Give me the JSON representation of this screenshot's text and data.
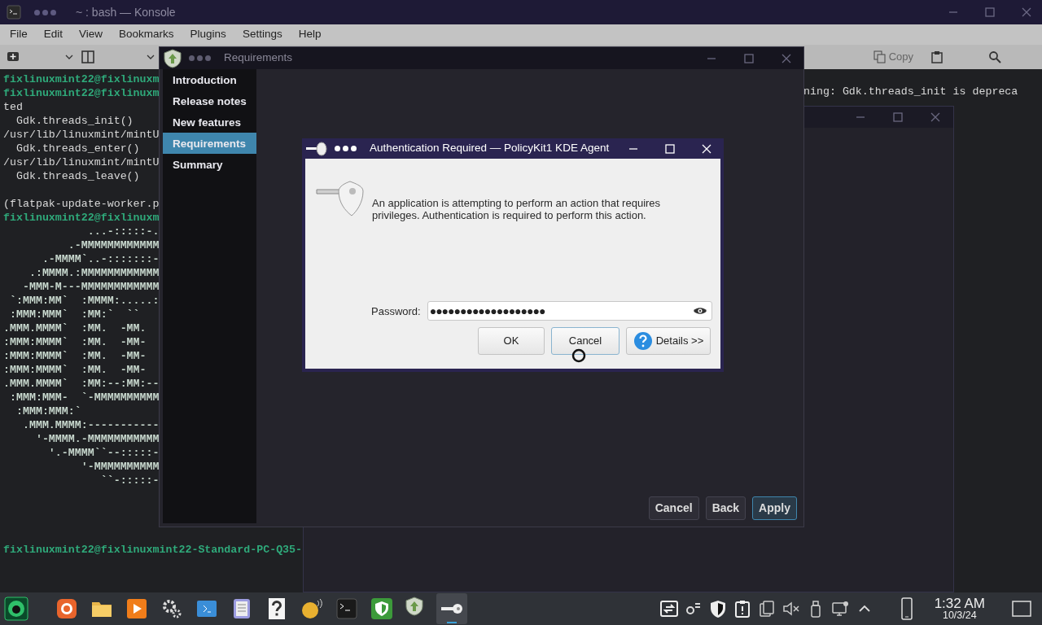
{
  "konsole": {
    "title": "~ : bash — Konsole",
    "menu": [
      "File",
      "Edit",
      "View",
      "Bookmarks",
      "Plugins",
      "Settings",
      "Help"
    ],
    "toolbar_right": {
      "copy_label": "Copy"
    },
    "terminal": {
      "lines": [
        {
          "kind": "prompt",
          "text": "fixlinuxmint22@fixlinuxm"
        },
        {
          "kind": "prompt",
          "text": "fixlinuxmint22@fixlinuxm"
        },
        {
          "kind": "output",
          "text": "ted"
        },
        {
          "kind": "output",
          "text": "  Gdk.threads_init()"
        },
        {
          "kind": "output",
          "text": "/usr/lib/linuxmint/mintU"
        },
        {
          "kind": "output",
          "text": "  Gdk.threads_enter()"
        },
        {
          "kind": "output",
          "text": "/usr/lib/linuxmint/mintU"
        },
        {
          "kind": "output",
          "text": "  Gdk.threads_leave()"
        },
        {
          "kind": "blank"
        },
        {
          "kind": "output",
          "text": "(flatpak-update-worker.p"
        },
        {
          "kind": "prompt",
          "text": "fixlinuxmint22@fixlinuxm"
        },
        {
          "kind": "art",
          "text": "             ...-:::::-."
        },
        {
          "kind": "art",
          "text": "          .-MMMMMMMMMMMM"
        },
        {
          "kind": "art",
          "text": "      .-MMMM`..-:::::::-"
        },
        {
          "kind": "art",
          "text": "    .:MMMM.:MMMMMMMMMMMM"
        },
        {
          "kind": "art",
          "text": "   -MMM-M---MMMMMMMMMMMM"
        },
        {
          "kind": "art",
          "text": " `:MMM:MM`  :MMMM:.....:"
        },
        {
          "kind": "art",
          "text": " :MMM:MMM`  :MM:`  ``"
        },
        {
          "kind": "art",
          "text": ".MMM.MMMM`  :MM.  -MM."
        },
        {
          "kind": "art",
          "text": ":MMM:MMMM`  :MM.  -MM-"
        },
        {
          "kind": "art",
          "text": ":MMM:MMMM`  :MM.  -MM-"
        },
        {
          "kind": "art",
          "text": ":MMM:MMMM`  :MM.  -MM-"
        },
        {
          "kind": "art",
          "text": ".MMM.MMMM`  :MM:--:MM:--"
        },
        {
          "kind": "art",
          "text": " :MMM:MMM-  `-MMMMMMMMMM"
        },
        {
          "kind": "art",
          "text": "  :MMM:MMM:`"
        },
        {
          "kind": "art",
          "text": "   .MMM.MMMM:-----------"
        },
        {
          "kind": "art",
          "text": "     '-MMMM.-MMMMMMMMMMM"
        },
        {
          "kind": "art",
          "text": "       '.-MMMM``--:::::-"
        },
        {
          "kind": "art",
          "text": "            '-MMMMMMMMMM"
        },
        {
          "kind": "art",
          "text": "               ``-:::::-"
        }
      ],
      "right_fragment": "ning: Gdk.threads_init is depreca",
      "bottom_prompt": "fixlinuxmint22@fixlinuxmint22-Standard-PC-Q35-"
    }
  },
  "upgrade_window": {
    "title": "Requirements",
    "sidebar": [
      {
        "label": "Introduction",
        "selected": false
      },
      {
        "label": "Release notes",
        "selected": false
      },
      {
        "label": "New features",
        "selected": false
      },
      {
        "label": "Requirements",
        "selected": true
      },
      {
        "label": "Summary",
        "selected": false
      }
    ],
    "buttons": [
      {
        "label": "Cancel",
        "selected": false
      },
      {
        "label": "Back",
        "selected": false
      },
      {
        "label": "Apply",
        "selected": true
      }
    ]
  },
  "auth_dialog": {
    "title": "Authentication Required — PolicyKit1 KDE Agent",
    "message": "An application is attempting to perform an action that requires privileges. Authentication is required to perform this action.",
    "password_label": "Password:",
    "password_value": "●●●●●●●●●●●●●●●●●●●",
    "buttons": [
      {
        "label": "OK",
        "selected": false
      },
      {
        "label": "Cancel",
        "selected": true
      },
      {
        "label": "Details >>",
        "selected": false
      }
    ]
  },
  "taskbar": {
    "apps": [
      {
        "selected": false
      },
      {
        "selected": false
      },
      {
        "selected": false
      },
      {
        "selected": false
      },
      {
        "selected": false
      },
      {
        "selected": false
      },
      {
        "selected": false
      },
      {
        "selected": false
      },
      {
        "selected": false
      },
      {
        "selected": false
      },
      {
        "selected": false
      },
      {
        "selected": true
      }
    ],
    "clock": {
      "time": "1:32 AM",
      "date": "10/3/24"
    }
  }
}
